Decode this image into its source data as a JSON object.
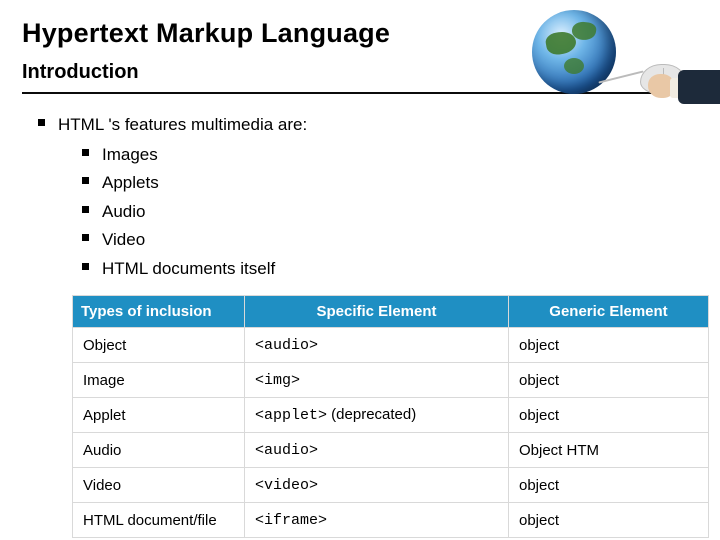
{
  "header": {
    "title": "Hypertext Markup Language",
    "subtitle": "Introduction"
  },
  "bullets": {
    "lead": "HTML 's features multimedia are:",
    "items": [
      "Images",
      "Applets",
      "Audio",
      "Video",
      "HTML documents itself"
    ]
  },
  "table": {
    "headers": [
      "Types of inclusion",
      "Specific Element",
      "Generic Element"
    ],
    "rows": [
      {
        "type": "Object",
        "specific": "<audio>",
        "note": "",
        "generic": "object"
      },
      {
        "type": "Image",
        "specific": "<img>",
        "note": "",
        "generic": "object"
      },
      {
        "type": "Applet",
        "specific": "<applet>",
        "note": " (deprecated)",
        "generic": "object"
      },
      {
        "type": "Audio",
        "specific": "<audio>",
        "note": "",
        "generic": "Object HTM"
      },
      {
        "type": "Video",
        "specific": "<video>",
        "note": "",
        "generic": "object"
      },
      {
        "type": "HTML document/file",
        "specific": "<iframe>",
        "note": "",
        "generic": "object"
      }
    ]
  }
}
